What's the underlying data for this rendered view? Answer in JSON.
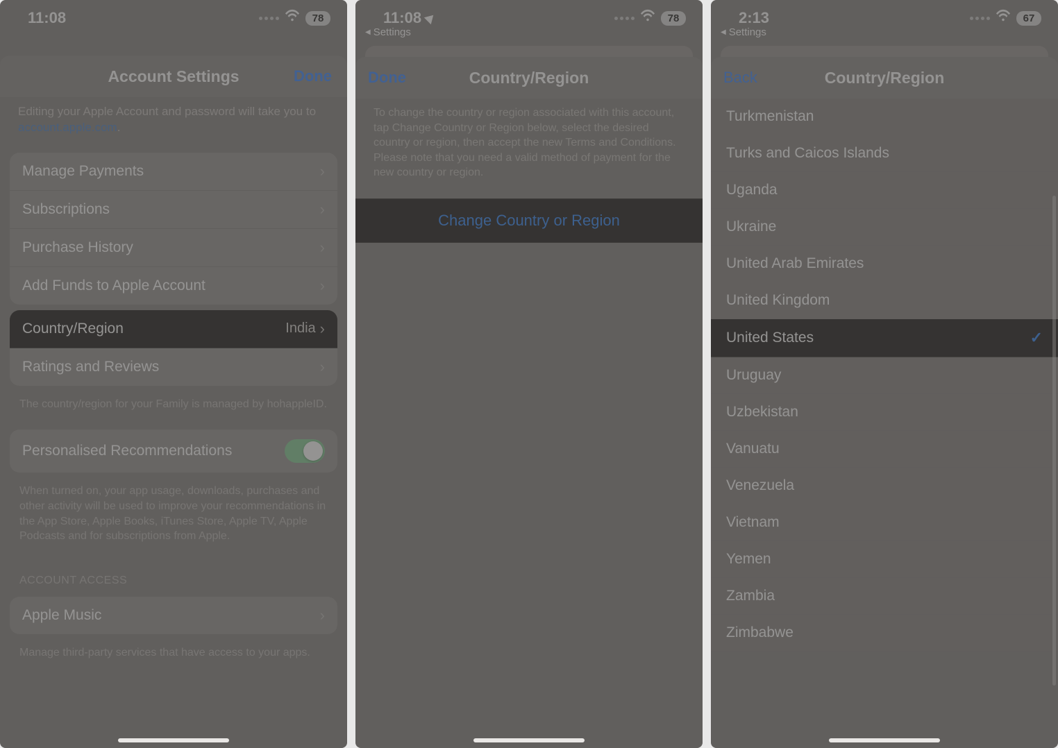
{
  "screen1": {
    "status": {
      "time": "11:08",
      "battery": "78"
    },
    "nav": {
      "title": "Account Settings",
      "done": "Done"
    },
    "info_prefix": "Editing your Apple Account and password will take you to ",
    "info_link": "account.apple.com",
    "info_suffix": ".",
    "rows_group1": [
      {
        "label": "Manage Payments"
      },
      {
        "label": "Subscriptions"
      },
      {
        "label": "Purchase History"
      },
      {
        "label": "Add Funds to Apple Account"
      }
    ],
    "country_row": {
      "label": "Country/Region",
      "value": "India"
    },
    "ratings_row": {
      "label": "Ratings and Reviews"
    },
    "family_footer": "The country/region for your Family is managed by hohappleID.",
    "personalised_label": "Personalised Recommendations",
    "personalised_footer": "When turned on, your app usage, downloads, purchases and other activity will be used to improve your recommendations in the App Store, Apple Books, iTunes Store, Apple TV, Apple Podcasts and for subscriptions from Apple.",
    "account_access_header": "ACCOUNT ACCESS",
    "apple_music_row": {
      "label": "Apple Music"
    },
    "apple_music_footer": "Manage third-party services that have access to your apps."
  },
  "screen2": {
    "status": {
      "time": "11:08",
      "battery": "78"
    },
    "back_settings": "Settings",
    "nav": {
      "title": "Country/Region",
      "done": "Done"
    },
    "description": "To change the country or region associated with this account, tap Change Country or Region below, select the desired country or region, then accept the new Terms and Conditions. Please note that you need a valid method of payment for the new country or region.",
    "change_button": "Change Country or Region"
  },
  "screen3": {
    "status": {
      "time": "2:13",
      "battery": "67"
    },
    "back_settings": "Settings",
    "nav": {
      "title": "Country/Region",
      "back": "Back"
    },
    "countries": [
      {
        "name": "Turkmenistan"
      },
      {
        "name": "Turks and Caicos Islands"
      },
      {
        "name": "Uganda"
      },
      {
        "name": "Ukraine"
      },
      {
        "name": "United Arab Emirates"
      },
      {
        "name": "United Kingdom"
      },
      {
        "name": "United States",
        "selected": true
      },
      {
        "name": "Uruguay"
      },
      {
        "name": "Uzbekistan"
      },
      {
        "name": "Vanuatu"
      },
      {
        "name": "Venezuela"
      },
      {
        "name": "Vietnam"
      },
      {
        "name": "Yemen"
      },
      {
        "name": "Zambia"
      },
      {
        "name": "Zimbabwe"
      }
    ]
  }
}
